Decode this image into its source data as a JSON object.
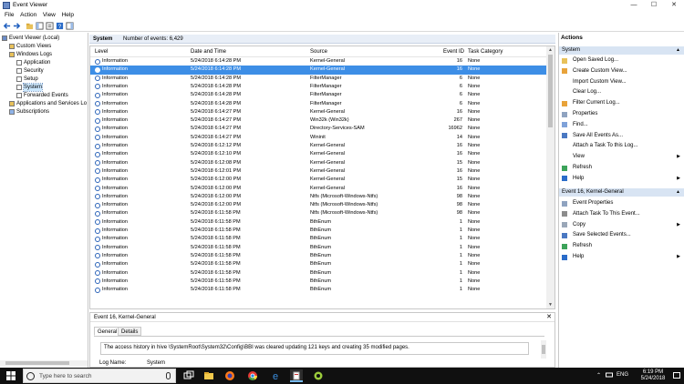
{
  "window": {
    "title": "Event Viewer",
    "minimize": "—",
    "maximize": "☐",
    "close": "✕"
  },
  "menu": [
    "File",
    "Action",
    "View",
    "Help"
  ],
  "tree": [
    {
      "label": "Event Viewer (Local)",
      "icon": "event-viewer-icon",
      "indent": 0
    },
    {
      "label": "Custom Views",
      "icon": "folder-icon",
      "indent": 1
    },
    {
      "label": "Windows Logs",
      "icon": "folder-icon",
      "indent": 1
    },
    {
      "label": "Application",
      "icon": "log-icon",
      "indent": 2
    },
    {
      "label": "Security",
      "icon": "log-icon",
      "indent": 2
    },
    {
      "label": "Setup",
      "icon": "log-icon",
      "indent": 2
    },
    {
      "label": "System",
      "icon": "log-icon",
      "indent": 2,
      "selected": true
    },
    {
      "label": "Forwarded Events",
      "icon": "log-icon",
      "indent": 2
    },
    {
      "label": "Applications and Services Lo",
      "icon": "folder-icon",
      "indent": 1
    },
    {
      "label": "Subscriptions",
      "icon": "subscriptions-icon",
      "indent": 1
    }
  ],
  "log_header": {
    "name": "System",
    "count": "Number of events: 6,429"
  },
  "columns": {
    "level": "Level",
    "date": "Date and Time",
    "source": "Source",
    "event_id": "Event ID",
    "task": "Task Category"
  },
  "events": [
    {
      "level": "Information",
      "date": "5/24/2018 6:14:28 PM",
      "source": "Kernel-General",
      "id": "16",
      "task": "None"
    },
    {
      "level": "Information",
      "date": "5/24/2018 6:14:28 PM",
      "source": "Kernel-General",
      "id": "16",
      "task": "None",
      "selected": true
    },
    {
      "level": "Information",
      "date": "5/24/2018 6:14:28 PM",
      "source": "FilterManager",
      "id": "6",
      "task": "None"
    },
    {
      "level": "Information",
      "date": "5/24/2018 6:14:28 PM",
      "source": "FilterManager",
      "id": "6",
      "task": "None"
    },
    {
      "level": "Information",
      "date": "5/24/2018 6:14:28 PM",
      "source": "FilterManager",
      "id": "6",
      "task": "None"
    },
    {
      "level": "Information",
      "date": "5/24/2018 6:14:28 PM",
      "source": "FilterManager",
      "id": "6",
      "task": "None"
    },
    {
      "level": "Information",
      "date": "5/24/2018 6:14:27 PM",
      "source": "Kernel-General",
      "id": "16",
      "task": "None"
    },
    {
      "level": "Information",
      "date": "5/24/2018 6:14:27 PM",
      "source": "Win32k (Win32k)",
      "id": "267",
      "task": "None"
    },
    {
      "level": "Information",
      "date": "5/24/2018 6:14:27 PM",
      "source": "Directory-Services-SAM",
      "id": "16962",
      "task": "None"
    },
    {
      "level": "Information",
      "date": "5/24/2018 6:14:27 PM",
      "source": "Wininit",
      "id": "14",
      "task": "None"
    },
    {
      "level": "Information",
      "date": "5/24/2018 6:12:12 PM",
      "source": "Kernel-General",
      "id": "16",
      "task": "None"
    },
    {
      "level": "Information",
      "date": "5/24/2018 6:12:10 PM",
      "source": "Kernel-General",
      "id": "16",
      "task": "None"
    },
    {
      "level": "Information",
      "date": "5/24/2018 6:12:08 PM",
      "source": "Kernel-General",
      "id": "15",
      "task": "None"
    },
    {
      "level": "Information",
      "date": "5/24/2018 6:12:01 PM",
      "source": "Kernel-General",
      "id": "16",
      "task": "None"
    },
    {
      "level": "Information",
      "date": "5/24/2018 6:12:00 PM",
      "source": "Kernel-General",
      "id": "15",
      "task": "None"
    },
    {
      "level": "Information",
      "date": "5/24/2018 6:12:00 PM",
      "source": "Kernel-General",
      "id": "16",
      "task": "None"
    },
    {
      "level": "Information",
      "date": "5/24/2018 6:12:00 PM",
      "source": "Ntfs (Microsoft-Windows-Ntfs)",
      "id": "98",
      "task": "None"
    },
    {
      "level": "Information",
      "date": "5/24/2018 6:12:00 PM",
      "source": "Ntfs (Microsoft-Windows-Ntfs)",
      "id": "98",
      "task": "None"
    },
    {
      "level": "Information",
      "date": "5/24/2018 6:11:58 PM",
      "source": "Ntfs (Microsoft-Windows-Ntfs)",
      "id": "98",
      "task": "None"
    },
    {
      "level": "Information",
      "date": "5/24/2018 6:11:58 PM",
      "source": "BthEnum",
      "id": "1",
      "task": "None"
    },
    {
      "level": "Information",
      "date": "5/24/2018 6:11:58 PM",
      "source": "BthEnum",
      "id": "1",
      "task": "None"
    },
    {
      "level": "Information",
      "date": "5/24/2018 6:11:58 PM",
      "source": "BthEnum",
      "id": "1",
      "task": "None"
    },
    {
      "level": "Information",
      "date": "5/24/2018 6:11:58 PM",
      "source": "BthEnum",
      "id": "1",
      "task": "None"
    },
    {
      "level": "Information",
      "date": "5/24/2018 6:11:58 PM",
      "source": "BthEnum",
      "id": "1",
      "task": "None"
    },
    {
      "level": "Information",
      "date": "5/24/2018 6:11:58 PM",
      "source": "BthEnum",
      "id": "1",
      "task": "None"
    },
    {
      "level": "Information",
      "date": "5/24/2018 6:11:58 PM",
      "source": "BthEnum",
      "id": "1",
      "task": "None"
    },
    {
      "level": "Information",
      "date": "5/24/2018 6:11:58 PM",
      "source": "BthEnum",
      "id": "1",
      "task": "None"
    },
    {
      "level": "Information",
      "date": "5/24/2018 6:11:58 PM",
      "source": "BthEnum",
      "id": "1",
      "task": "None"
    }
  ],
  "detail": {
    "title": "Event 16, Kernel-General",
    "close": "✕",
    "tabs": [
      "General",
      "Details"
    ],
    "description": "The access history in hive \\SystemRoot\\System32\\Config\\BBI was cleared updating 121 keys and creating 35 modified pages.",
    "log_name_label": "Log Name:",
    "log_name_value": "System"
  },
  "actions": {
    "title": "Actions",
    "section1": "System",
    "items1": [
      {
        "label": "Open Saved Log...",
        "icon": "open-log-icon"
      },
      {
        "label": "Create Custom View...",
        "icon": "filter-icon"
      },
      {
        "label": "Import Custom View...",
        "icon": ""
      },
      {
        "label": "Clear Log...",
        "icon": ""
      },
      {
        "label": "Filter Current Log...",
        "icon": "filter-icon"
      },
      {
        "label": "Properties",
        "icon": "properties-icon"
      },
      {
        "label": "Find...",
        "icon": "find-icon"
      },
      {
        "label": "Save All Events As...",
        "icon": "save-icon"
      },
      {
        "label": "Attach a Task To this Log...",
        "icon": ""
      },
      {
        "label": "View",
        "icon": "",
        "submenu": true
      },
      {
        "label": "Refresh",
        "icon": "refresh-icon"
      },
      {
        "label": "Help",
        "icon": "help-icon",
        "submenu": true
      }
    ],
    "section2": "Event 16, Kernel-General",
    "items2": [
      {
        "label": "Event Properties",
        "icon": "properties-icon"
      },
      {
        "label": "Attach Task To This Event...",
        "icon": "task-icon"
      },
      {
        "label": "Copy",
        "icon": "copy-icon",
        "submenu": true
      },
      {
        "label": "Save Selected Events...",
        "icon": "save-icon"
      },
      {
        "label": "Refresh",
        "icon": "refresh-icon"
      },
      {
        "label": "Help",
        "icon": "help-icon",
        "submenu": true
      }
    ]
  },
  "taskbar": {
    "search_placeholder": "Type here to search",
    "time": "6:19 PM",
    "date": "5/24/2018",
    "lang": "ENG"
  },
  "colors": {
    "selection": "#3d8ee6",
    "tree_selection": "#cce8ff",
    "section_bg": "#d8e4f3",
    "taskbar": "#101010"
  }
}
